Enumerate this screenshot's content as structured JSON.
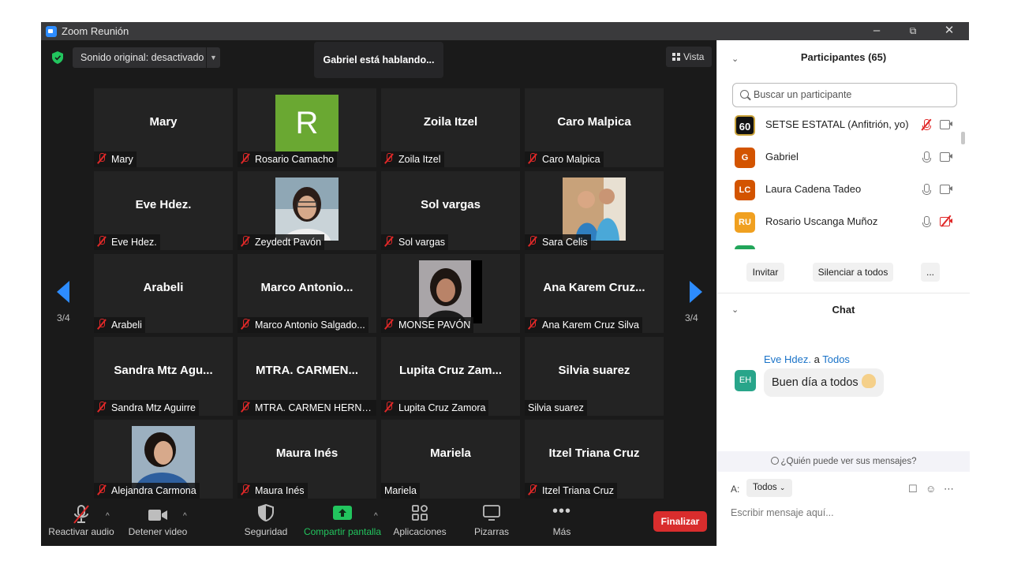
{
  "window": {
    "title": "Zoom Reunión"
  },
  "video": {
    "sound_label": "Sonido original: desactivado",
    "speaking": "Gabriel está hablando...",
    "view_label": "Vista",
    "page_left": "3/4",
    "page_right": "3/4",
    "tiles": [
      {
        "name": "Mary",
        "label": "Mary"
      },
      {
        "name": "",
        "avatar_letter": "R",
        "label": "Rosario Camacho"
      },
      {
        "name": "Zoila Itzel",
        "label": "Zoila Itzel"
      },
      {
        "name": "Caro Malpica",
        "label": "Caro Malpica"
      },
      {
        "name": "Eve Hdez.",
        "label": "Eve Hdez."
      },
      {
        "name": "",
        "label": "Zeydedt Pavón"
      },
      {
        "name": "Sol vargas",
        "label": "Sol vargas"
      },
      {
        "name": "",
        "label": "Sara Celis"
      },
      {
        "name": "Arabeli",
        "label": "Arabeli"
      },
      {
        "name": "Marco  Antonio...",
        "label": "Marco Antonio Salgado..."
      },
      {
        "name": "",
        "label": "MONSE PAVÓN"
      },
      {
        "name": "Ana Karem  Cruz...",
        "label": "Ana Karem Cruz Silva"
      },
      {
        "name": "Sandra  Mtz  Agu...",
        "label": "Sandra Mtz Aguirre"
      },
      {
        "name": "MTRA.  CARMEN...",
        "label": "MTRA. CARMEN HERNA..."
      },
      {
        "name": "Lupita  Cruz  Zam...",
        "label": "Lupita Cruz Zamora"
      },
      {
        "name": "Silvia suarez",
        "label": "Silvia suarez"
      },
      {
        "name": "",
        "label": "Alejandra Carmona"
      },
      {
        "name": "Maura Inés",
        "label": "Maura Inés"
      },
      {
        "name": "Mariela",
        "label": "Mariela"
      },
      {
        "name": "Itzel Triana Cruz",
        "label": "Itzel Triana Cruz"
      }
    ]
  },
  "toolbar": {
    "audio": "Reactivar audio",
    "video": "Detener video",
    "security": "Seguridad",
    "share": "Compartir pantalla",
    "apps": "Aplicaciones",
    "whiteboards": "Pizarras",
    "more": "Más",
    "end": "Finalizar"
  },
  "participants": {
    "header": "Participantes (65)",
    "search_placeholder": "Buscar un participante",
    "list": [
      {
        "initials": "60",
        "name": "SETSE ESTATAL (Anfitrión, yo)",
        "color": "#111111"
      },
      {
        "initials": "G",
        "name": "Gabriel",
        "color": "#d35400"
      },
      {
        "initials": "LC",
        "name": "Laura Cadena Tadeo",
        "color": "#d35400"
      },
      {
        "initials": "RU",
        "name": "Rosario Uscanga Muñoz",
        "color": "#f0a020"
      }
    ],
    "invite": "Invitar",
    "mute_all": "Silenciar a todos",
    "more": "..."
  },
  "chat": {
    "header": "Chat",
    "sender": "Eve Hdez.",
    "to_word": "a",
    "recipient": "Todos",
    "avatar": "EH",
    "message": "Buen día a todos",
    "who_can_see": "¿Quién puede ver sus mensajes?",
    "to_label": "A:",
    "to_value": "Todos",
    "input_placeholder": "Escribir mensaje aquí..."
  }
}
